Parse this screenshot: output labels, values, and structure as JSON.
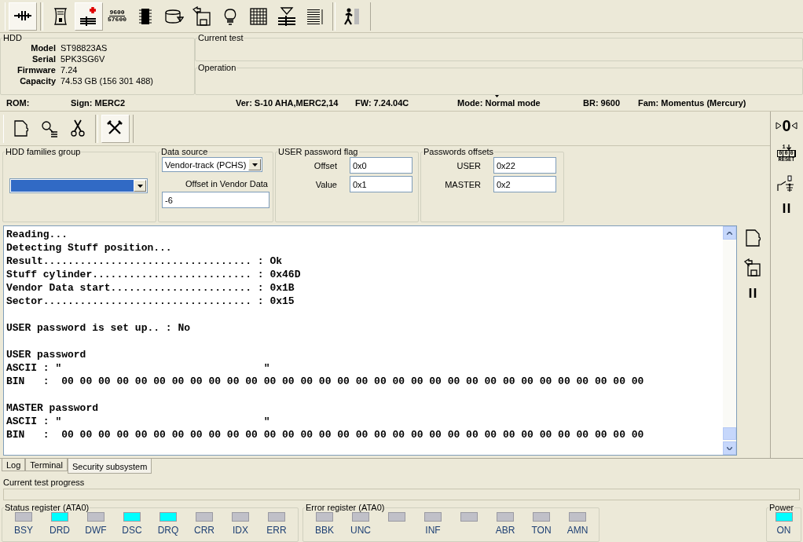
{
  "toolbar": {
    "groups": [
      [
        {
          "pressed": true
        }
      ],
      [
        {
          "pressed": false
        },
        {
          "pressed": true
        },
        {
          "pressed": false,
          "text": [
            "9600",
            "57600"
          ]
        },
        {
          "pressed": false
        },
        {
          "pressed": false
        },
        {
          "pressed": false
        },
        {
          "pressed": false
        },
        {
          "pressed": false
        },
        {
          "pressed": false
        },
        {
          "pressed": false
        }
      ],
      [
        {
          "pressed": false
        }
      ]
    ]
  },
  "hdd": {
    "title": "HDD",
    "fields": [
      {
        "label": "Model",
        "value": "ST98823AS"
      },
      {
        "label": "Serial",
        "value": "5PK3SG6V"
      },
      {
        "label": "Firmware",
        "value": "7.24"
      },
      {
        "label": "Capacity",
        "value": "74.53 GB (156 301 488)"
      }
    ]
  },
  "current_test": {
    "title": "Current test"
  },
  "operation": {
    "title": "Operation"
  },
  "status_line": [
    "ROM:",
    "Sign: MERC2",
    "Ver: S-10 AHA,MERC2,14",
    "FW: 7.24.04C",
    "Mode: Normal mode",
    "BR: 9600",
    "Fam: Momentus (Mercury)"
  ],
  "tool_panel": {
    "toolbar": {
      "groups": [
        [
          {
            "pressed": false
          },
          {
            "pressed": false
          },
          {
            "pressed": false
          }
        ],
        [
          {
            "pressed": true
          }
        ]
      ]
    },
    "hdd_families_group": {
      "title": "HDD families group",
      "focused": true
    },
    "data_source": {
      "title": "Data source",
      "value": "Vendor-track (PCHS)",
      "offset_label": "Offset in Vendor Data",
      "offset_value": "-6"
    },
    "user_password_flag": {
      "title": "USER password flag",
      "fields": [
        {
          "label": "Offset",
          "value": "0x0"
        },
        {
          "label": "Value",
          "value": "0x1"
        }
      ]
    },
    "passwords_offsets": {
      "title": "Passwords offsets",
      "fields": [
        {
          "label": "USER",
          "value": "0x22"
        },
        {
          "label": "MASTER",
          "value": "0x2"
        }
      ]
    }
  },
  "terminal": {
    "blocks": [
      [
        "Reading...",
        "Detecting Stuff position...",
        "Result.................................. : Ok",
        "Stuff cylinder.......................... : 0x46D",
        "Vendor Data start....................... : 0x1B",
        "Sector.................................. : 0x15"
      ],
      [
        "USER password is set up.. : No"
      ],
      [
        "USER password",
        "ASCII : \"                                 \"",
        "BIN   :  00 00 00 00 00 00 00 00 00 00 00 00 00 00 00 00 00 00 00 00 00 00 00 00 00 00 00 00 00 00 00 00"
      ],
      [
        "MASTER password",
        "ASCII : \"                                 \"",
        "BIN   :  00 00 00 00 00 00 00 00 00 00 00 00 00 00 00 00 00 00 00 00 00 00 00 00 00 00 00 00 00 00 00 00"
      ]
    ]
  },
  "right_sidebar": {
    "counter": "0",
    "reset": {
      "index": "1",
      "digits": [
        "0",
        "0",
        "0"
      ],
      "caption": "RESET"
    }
  },
  "tabs": [
    {
      "label": "Log",
      "selected": false
    },
    {
      "label": "Terminal",
      "selected": false
    },
    {
      "label": "Security subsystem",
      "selected": true
    }
  ],
  "progress": {
    "title": "Current test progress",
    "level": 0
  },
  "status_register": {
    "title": "Status register (ATA0)",
    "leds": [
      {
        "label": "BSY",
        "on": false
      },
      {
        "label": "DRD",
        "on": true
      },
      {
        "label": "DWF",
        "on": false
      },
      {
        "label": "DSC",
        "on": true
      },
      {
        "label": "DRQ",
        "on": true
      },
      {
        "label": "CRR",
        "on": false
      },
      {
        "label": "IDX",
        "on": false
      },
      {
        "label": "ERR",
        "on": false
      }
    ]
  },
  "error_register": {
    "title": "Error register (ATA0)",
    "leds": [
      {
        "label": "BBK",
        "on": false
      },
      {
        "label": "UNC",
        "on": false
      },
      {
        "on": false
      },
      {
        "label": "INF",
        "on": false
      },
      {
        "on": false
      },
      {
        "label": "ABR",
        "on": false
      },
      {
        "label": "TON",
        "on": false
      },
      {
        "label": "AMN",
        "on": false
      }
    ]
  },
  "power": {
    "title": "Power",
    "leds": [
      {
        "label": "ON",
        "on": true
      }
    ]
  }
}
